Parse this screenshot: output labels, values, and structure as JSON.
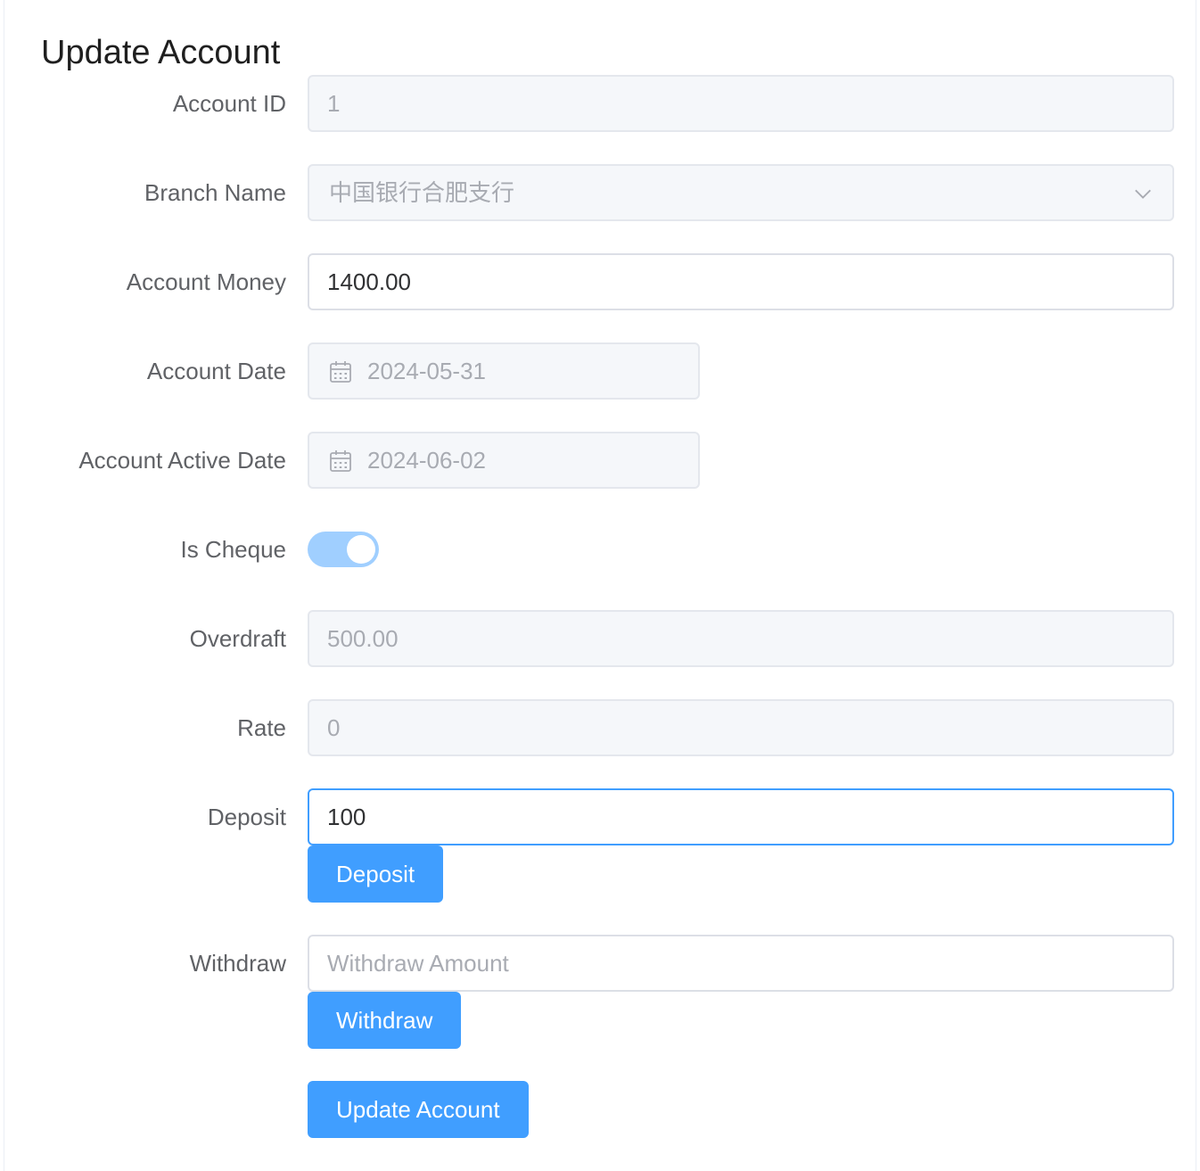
{
  "page": {
    "title": "Update Account"
  },
  "form": {
    "account_id": {
      "label": "Account ID",
      "value": "1"
    },
    "branch_name": {
      "label": "Branch Name",
      "value": "中国银行合肥支行"
    },
    "account_money": {
      "label": "Account Money",
      "value": "1400.00"
    },
    "account_date": {
      "label": "Account Date",
      "value": "2024-05-31"
    },
    "account_active_date": {
      "label": "Account Active Date",
      "value": "2024-06-02"
    },
    "is_cheque": {
      "label": "Is Cheque",
      "on": true
    },
    "overdraft": {
      "label": "Overdraft",
      "value": "500.00"
    },
    "rate": {
      "label": "Rate",
      "value": "0"
    },
    "deposit": {
      "label": "Deposit",
      "value": "100",
      "button_label": "Deposit"
    },
    "withdraw": {
      "label": "Withdraw",
      "value": "",
      "placeholder": "Withdraw Amount",
      "button_label": "Withdraw"
    },
    "submit_label": "Update Account"
  },
  "colors": {
    "primary": "#409eff",
    "switch_on": "#a0cfff",
    "disabled_bg": "#f5f7fa",
    "label": "#606266"
  }
}
